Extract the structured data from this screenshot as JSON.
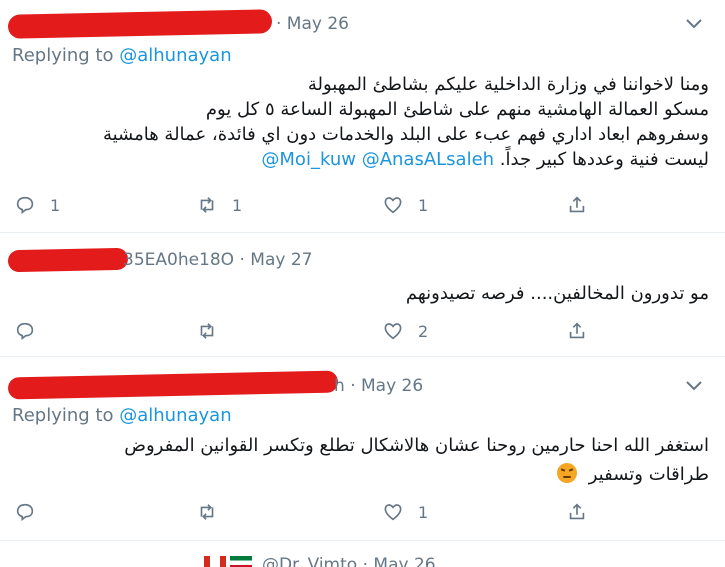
{
  "tweets": [
    {
      "handle_suffix": "",
      "date": "· May 26",
      "replying_prefix": "Replying to",
      "replying_to": "@alhunayan",
      "lines": [
        "ومنا لاخواننا في وزارة الداخلية عليكم بشاطئ المهبولة",
        "مسكو العمالة الهامشية منهم على شاطئ المهبولة الساعة ٥ كل يوم",
        "وسفروهم ابعاد اداري فهم عبء على البلد والخدمات دون اي فائدة، عمالة هامشية",
        "ليست فنية وعددها كبير جداً."
      ],
      "mentions": [
        "@AnasALsaleh",
        "@Moi_kuw"
      ],
      "reply_count": "1",
      "retweet_count": "1",
      "like_count": "1"
    },
    {
      "handle_suffix": "35EA0he18O",
      "date": "· May 27",
      "lines": [
        "مو تدورون المخالفين.... فرصه تصيدونهم"
      ],
      "reply_count": "",
      "retweet_count": "",
      "like_count": "2"
    },
    {
      "handle_suffix": "h",
      "date": "· May 26",
      "replying_prefix": "Replying to",
      "replying_to": "@alhunayan",
      "lines": [
        "استغفر الله احنا حارمين روحنا عشان هالاشكال تطلع وتكسر القوانين المفروض",
        "طراقات وتسفير"
      ],
      "emoji": "angry-face-emoji",
      "reply_count": "",
      "retweet_count": "",
      "like_count": "1"
    },
    {
      "partial_text": "@Dr_Vimto · May 26"
    }
  ],
  "colors": {
    "text": "#14171a",
    "muted": "#657786",
    "link": "#1b95e0",
    "redaction": "#e31b1b",
    "divider": "#e6ecf0"
  },
  "icons": [
    "reply-icon",
    "retweet-icon",
    "like-icon",
    "share-icon",
    "chevron-down-icon"
  ]
}
